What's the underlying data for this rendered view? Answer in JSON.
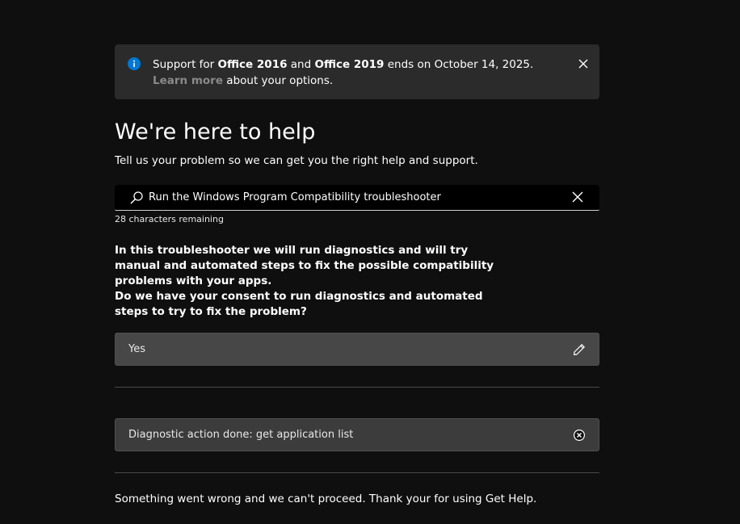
{
  "banner": {
    "text_prefix": "Support for ",
    "product_1": "Office 2016",
    "text_and": " and ",
    "product_2": "Office 2019",
    "text_ends": " ends on October 14, 2025. ",
    "link_text": "Learn more",
    "text_suffix": " about your options.",
    "icon": "info-icon",
    "close_icon": "close-icon",
    "accent_color": "#0078d4"
  },
  "header": {
    "title": "We're here to help",
    "subtitle": "Tell us your problem so we can get you the right help and support."
  },
  "search": {
    "value": "Run the Windows Program Compatibility troubleshooter",
    "chars_remaining": "28 characters remaining",
    "icon": "search-icon",
    "clear_icon": "close-icon"
  },
  "conversation": {
    "intro": "In this troubleshooter we will run diagnostics and will try manual and automated steps to fix the possible compatibility problems with your apps.",
    "consent_question": "Do we have your consent to run diagnostics and automated steps to try to fix the problem?",
    "answer_yes": "Yes",
    "answer_edit_icon": "pencil-icon",
    "diagnostic_status": "Diagnostic action done: get application list",
    "diagnostic_icon": "error-circle-icon",
    "final_message": "Something went wrong and we can't proceed. Thank your for using Get Help."
  }
}
